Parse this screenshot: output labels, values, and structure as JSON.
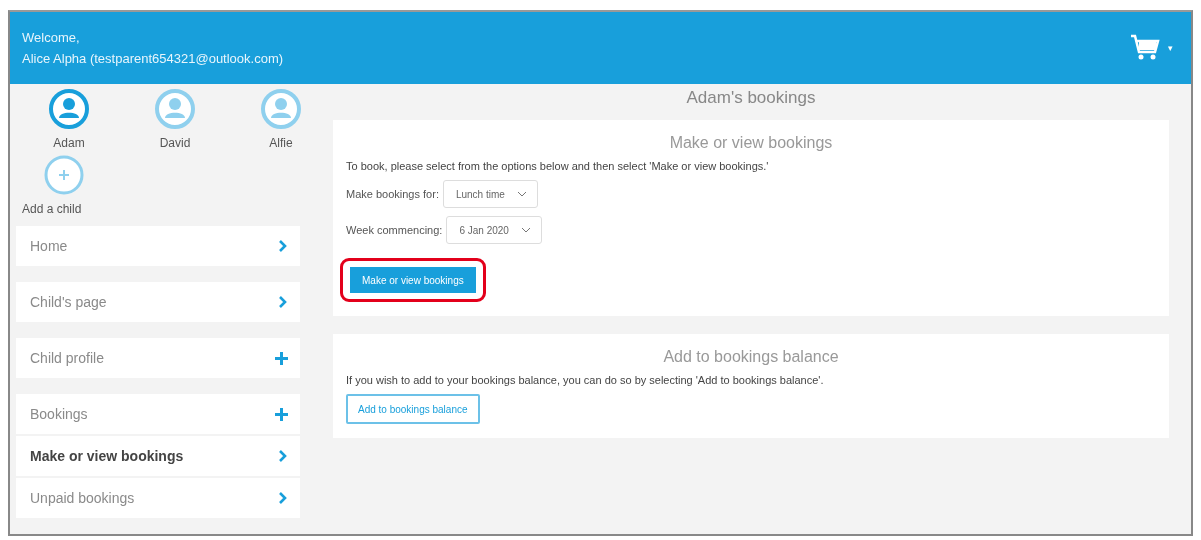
{
  "header": {
    "welcome": "Welcome,",
    "user": "Alice Alpha (testparent654321@outlook.com)",
    "cart_caret": "▾"
  },
  "children": [
    {
      "name": "Adam",
      "selected": true
    },
    {
      "name": "David",
      "selected": false
    },
    {
      "name": "Alfie",
      "selected": false
    }
  ],
  "add_child": {
    "label": "Add a child"
  },
  "nav": [
    {
      "label": "Home",
      "kind": "chevron",
      "selected": false
    },
    {
      "label": "Child's page",
      "kind": "chevron",
      "selected": false
    },
    {
      "label": "Child profile",
      "kind": "plus",
      "selected": false
    },
    {
      "label": "Bookings",
      "kind": "plus",
      "selected": false,
      "children": [
        {
          "label": "Make or view bookings",
          "kind": "chevron",
          "selected": true
        },
        {
          "label": "Unpaid bookings",
          "kind": "chevron",
          "selected": false
        }
      ]
    }
  ],
  "page_title": "Adam's bookings",
  "make_card": {
    "title": "Make or view bookings",
    "instructions": "To book, please select from the options below and then select 'Make or view bookings.'",
    "fields": [
      {
        "label": "Make bookings for:",
        "value": "Lunch time"
      },
      {
        "label": "Week commencing:",
        "value": "6 Jan 2020"
      }
    ],
    "button": {
      "label": "Make or view bookings",
      "highlighted": true
    }
  },
  "balance_card": {
    "title": "Add to bookings balance",
    "instructions": "If you wish to add to your bookings balance, you can do so by selecting 'Add to bookings balance'.",
    "button": {
      "label": "Add to bookings balance",
      "highlighted": false
    }
  }
}
